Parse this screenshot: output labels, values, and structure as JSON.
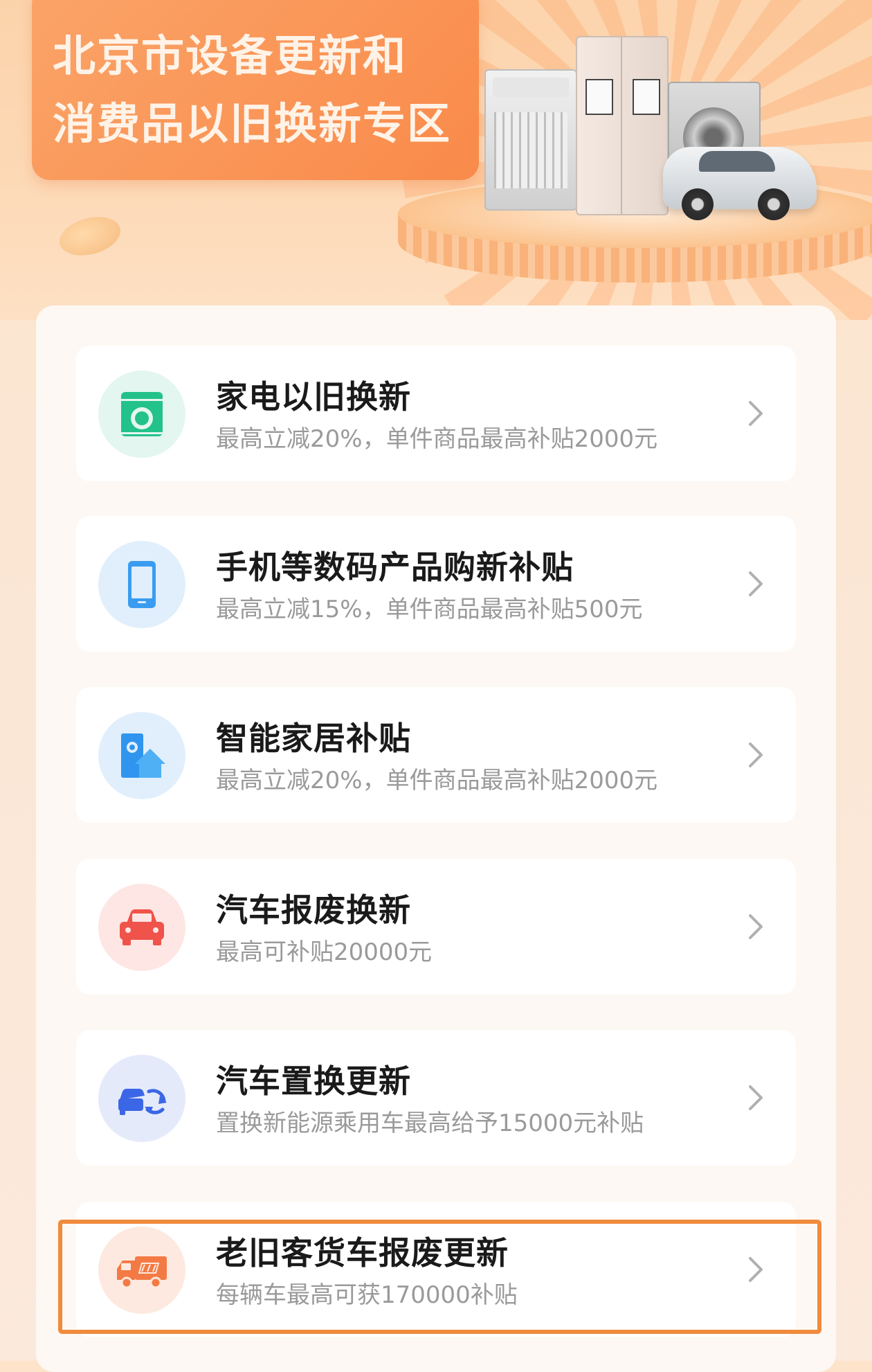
{
  "banner": {
    "title_line1": "北京市设备更新和",
    "title_line2": "消费品以旧换新专区"
  },
  "items": [
    {
      "title": "家电以旧换新",
      "subtitle": "最高立减20%，单件商品最高补贴2000元",
      "icon": "washing-machine-icon",
      "icon_color": "#22c28a",
      "icon_bg": "#e3f6ef"
    },
    {
      "title": "手机等数码产品购新补贴",
      "subtitle": "最高立减15%，单件商品最高补贴500元",
      "icon": "phone-icon",
      "icon_color": "#3a9cf0",
      "icon_bg": "#e1effc"
    },
    {
      "title": "智能家居补贴",
      "subtitle": "最高立减20%，单件商品最高补贴2000元",
      "icon": "smart-home-icon",
      "icon_color": "#2f95ee",
      "icon_bg": "#e1effc"
    },
    {
      "title": "汽车报废换新",
      "subtitle": "最高可补贴20000元",
      "icon": "car-icon",
      "icon_color": "#f0534a",
      "icon_bg": "#fde6e4"
    },
    {
      "title": "汽车置换更新",
      "subtitle": "置换新能源乘用车最高给予15000元补贴",
      "icon": "car-swap-icon",
      "icon_color": "#3b66e6",
      "icon_bg": "#e5eafb"
    },
    {
      "title": "老旧客货车报废更新",
      "subtitle": "每辆车最高可获170000补贴",
      "icon": "truck-icon",
      "icon_color": "#f47a45",
      "icon_bg": "#fde9df"
    }
  ],
  "highlight_color": "#f08b3c"
}
